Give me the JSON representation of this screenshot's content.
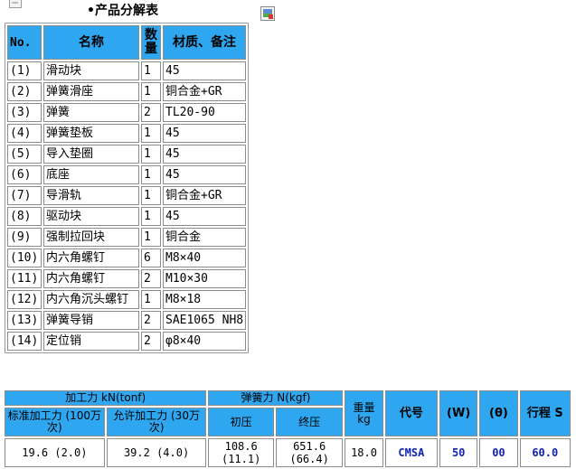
{
  "title": "•产品分解表",
  "parts_table": {
    "headers": [
      "No.",
      "名称",
      "数量",
      "材质、备注"
    ],
    "rows": [
      [
        "(1)",
        "滑动块",
        "1",
        "45"
      ],
      [
        "(2)",
        "弹簧滑座",
        "1",
        "铜合金+GR"
      ],
      [
        "(3)",
        "弹簧",
        "2",
        "TL20-90"
      ],
      [
        "(4)",
        "弹簧垫板",
        "1",
        "45"
      ],
      [
        "(5)",
        "导入垫圈",
        "1",
        "45"
      ],
      [
        "(6)",
        "底座",
        "1",
        "45"
      ],
      [
        "(7)",
        "导滑轨",
        "1",
        "铜合金+GR"
      ],
      [
        "(8)",
        "驱动块",
        "1",
        "45"
      ],
      [
        "(9)",
        "强制拉回块",
        "1",
        "铜合金"
      ],
      [
        "(10)",
        "内六角螺钉",
        "6",
        "M8×40"
      ],
      [
        "(11)",
        "内六角螺钉",
        "2",
        "M10×30"
      ],
      [
        "(12)",
        "内六角沉头螺钉",
        "1",
        "M8×18"
      ],
      [
        "(13)",
        "弹簧导销",
        "2",
        "SAE1065 NH8"
      ],
      [
        "(14)",
        "定位销",
        "2",
        "φ8×40"
      ]
    ]
  },
  "spec_table": {
    "h_force": "加工力 kN(tonf)",
    "h_spring": "弹簧力 N(kgf)",
    "h_weight": "重量 kg",
    "h_code": "代号",
    "h_w": "(W)",
    "h_theta": "(θ)",
    "h_stroke": "行程 S",
    "h_std": "标准加工力 (100万次)",
    "h_allow": "允许加工力 (30万次)",
    "h_initial": "初压",
    "h_final": "终压",
    "row": {
      "std": "19.6 (2.0)",
      "allow": "39.2 (4.0)",
      "initial": "108.6 (11.1)",
      "final": "651.6 (66.4)",
      "weight": "18.0",
      "code": "CMSA",
      "w": "50",
      "theta": "00",
      "stroke": "60.0"
    }
  }
}
